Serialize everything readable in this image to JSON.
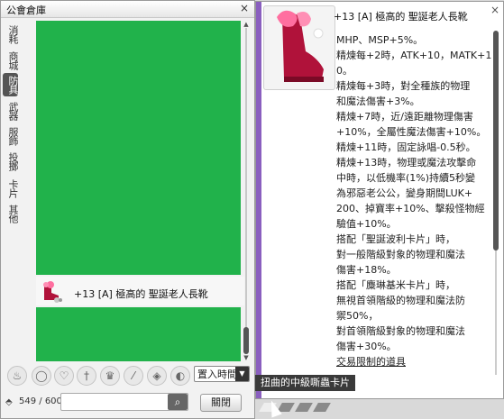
{
  "storage": {
    "title": "公會倉庫",
    "close_glyph": "×",
    "tabs": [
      "消耗",
      "商城",
      "防具",
      "武器",
      "服飾",
      "投擲",
      "卡片",
      "其他"
    ],
    "active_tab": "防具",
    "item": {
      "name": "+13 [A] 極高的 聖誕老人長靴"
    },
    "sort_label": "置入時間",
    "count": "549 / 600",
    "search_placeholder": "",
    "close_button": "關閉",
    "filter_icons": [
      "potion-icon",
      "ring-icon",
      "armor-icon",
      "sword-icon",
      "crown-icon",
      "wand-icon",
      "card-icon",
      "compass-icon"
    ],
    "colors": {
      "content_bg": "#21b24b",
      "accent": "#8a5fbf"
    }
  },
  "info": {
    "title": "+13 [A] 極高的 聖誕老人長靴",
    "close_glyph": "×",
    "lines": [
      "MHP、MSP+5%。",
      "精煉每+2時，ATK+10，MATK+1",
      "0。",
      "精煉每+3時，對全種族的物理",
      "和魔法傷害+3%。",
      "精煉+7時，近/遠距離物理傷害",
      "+10%，全屬性魔法傷害+10%。",
      "精煉+11時，固定詠唱-0.5秒。",
      "精煉+13時，物理或魔法攻擊命",
      "中時，以低機率(1%)持續5秒變",
      "為邪惡老公公，變身期間LUK+",
      "200、掉寶率+10%、擊殺怪物經",
      "驗值+10%。",
      "搭配「聖誕波利卡片」時，",
      "對一般階級對象的物理和魔法",
      "傷害+18%。",
      "搭配「麋琳基米卡片」時，",
      "無視首領階級的物理和魔法防",
      "禦50%，",
      "對首領階級對象的物理和魔法",
      "傷害+30%。",
      "交易限制的道具"
    ],
    "tooltip": "扭曲的中級嘶蟲卡片"
  }
}
